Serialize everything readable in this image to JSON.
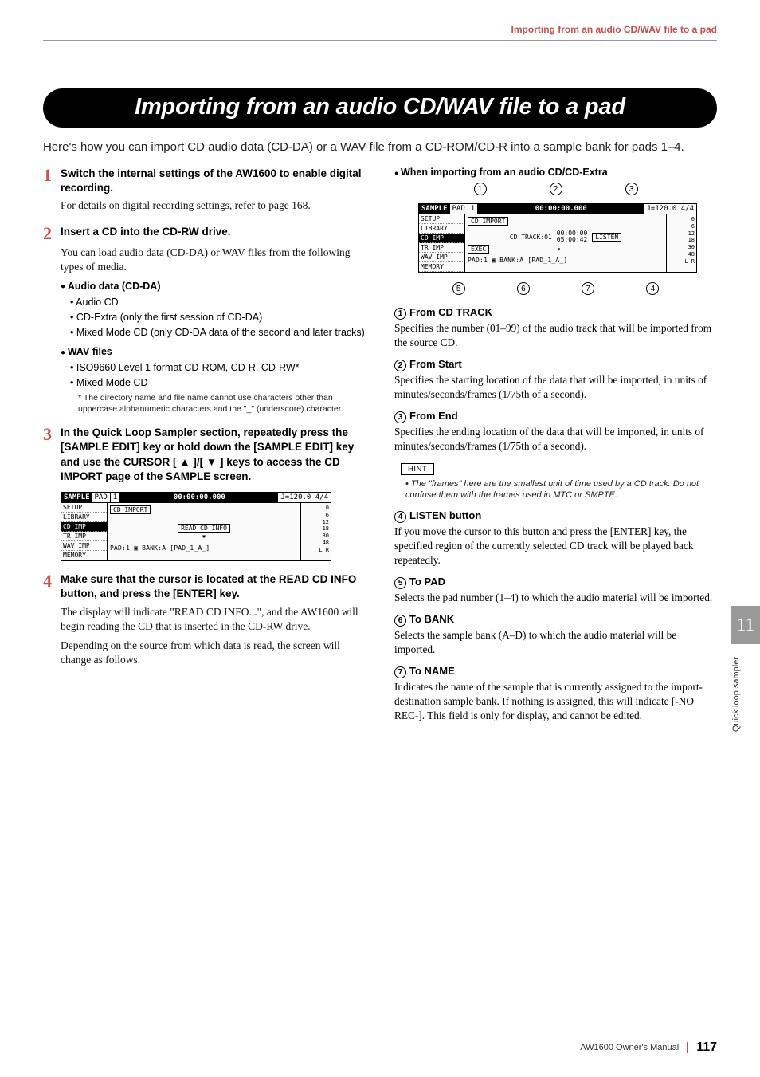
{
  "header": {
    "running": "Importing from an audio CD/WAV file to a pad"
  },
  "title": "Importing from an audio CD/WAV file to a pad",
  "intro": "Here's how you can import CD audio data (CD-DA) or a WAV file from a CD-ROM/CD-R into a sample bank for pads 1–4.",
  "steps": {
    "s1": {
      "num": "1",
      "head": "Switch the internal settings of the AW1600 to enable digital recording.",
      "body": "For details on digital recording settings, refer to page 168."
    },
    "s2": {
      "num": "2",
      "head": "Insert a CD into the CD-RW drive.",
      "body": "You can load audio data (CD-DA) or WAV files from the following types of media.",
      "bhead1": "Audio data (CD-DA)",
      "b1a": "Audio CD",
      "b1b": "CD-Extra (only the first session of CD-DA)",
      "b1c": "Mixed Mode CD (only CD-DA data of the second and later tracks)",
      "bhead2": "WAV files",
      "b2a": "ISO9660 Level 1 format CD-ROM, CD-R, CD-RW*",
      "b2b": "Mixed Mode CD",
      "foot": "* The directory name and file name cannot use characters other than uppercase alphanumeric characters and the \"_\" (underscore) character."
    },
    "s3": {
      "num": "3",
      "head": "In the Quick Loop Sampler section, repeatedly press the [SAMPLE EDIT] key or hold down the [SAMPLE EDIT] key and use the CURSOR [ ▲ ]/[ ▼ ] keys to access the CD IMPORT page of the SAMPLE screen."
    },
    "s4": {
      "num": "4",
      "head": "Make sure that the cursor is located at the READ CD INFO button, and press the [ENTER] key.",
      "body1": "The display will indicate \"READ CD INFO...\", and the AW1600 will begin reading the CD that is inserted in the CD-RW drive.",
      "body2": "Depending on the source from which data is read, the screen will change as follows."
    }
  },
  "right": {
    "bhead": "When importing from an audio CD/CD-Extra",
    "i1": {
      "n": "1",
      "t": "From CD TRACK",
      "b": "Specifies the number (01–99) of the audio track that will be imported from the source CD."
    },
    "i2": {
      "n": "2",
      "t": "From Start",
      "b": "Specifies the starting location of the data that will be imported, in units of minutes/seconds/frames (1/75th of a second)."
    },
    "i3": {
      "n": "3",
      "t": "From End",
      "b": "Specifies the ending location of the data that will be imported, in units of minutes/seconds/frames (1/75th of a second)."
    },
    "hint": {
      "tab": "HINT",
      "body": "The \"frames\" here are the smallest unit of time used by a CD track. Do not confuse them with the frames used in MTC or SMPTE."
    },
    "i4": {
      "n": "4",
      "t": "LISTEN button",
      "b": "If you move the cursor to this button and press the [ENTER] key, the specified region of the currently selected CD track will be played back repeatedly."
    },
    "i5": {
      "n": "5",
      "t": "To PAD",
      "b": "Selects the pad number (1–4) to which the audio material will be imported."
    },
    "i6": {
      "n": "6",
      "t": "To BANK",
      "b": "Selects the sample bank (A–D) to which the audio material will be imported."
    },
    "i7": {
      "n": "7",
      "t": "To NAME",
      "b": "Indicates the name of the sample that is currently assigned to the import-destination sample bank. If nothing is assigned, this will indicate [-NO REC-]. This field is only for display, and cannot be edited."
    }
  },
  "screen": {
    "title": "SAMPLE",
    "pad": "PAD",
    "pn": "1",
    "time": "00:00:00.000",
    "tempo": "J=120.0 4/4",
    "menu": {
      "a": "SETUP",
      "b": "LIBRARY",
      "c": "CD  IMP",
      "d": "TR  IMP",
      "e": "WAV IMP",
      "f": "MEMORY"
    },
    "cdimport": "CD IMPORT",
    "read": "READ CD INFO",
    "foot": "PAD:1  ▣  BANK:A [PAD_1_A_]",
    "meters": {
      "a": "0",
      "b": "6",
      "c": "12",
      "d": "18",
      "e": "30",
      "f": "48",
      "lr": "L R"
    },
    "right2": {
      "track": "CD TRACK:01",
      "t1": "00:00:00",
      "t2": "05:00:42",
      "listen": "LISTEN",
      "exec": "EXEC"
    }
  },
  "side": {
    "num": "11",
    "text": "Quick loop sampler"
  },
  "footer": {
    "manual": "AW1600  Owner's Manual",
    "page": "117"
  }
}
